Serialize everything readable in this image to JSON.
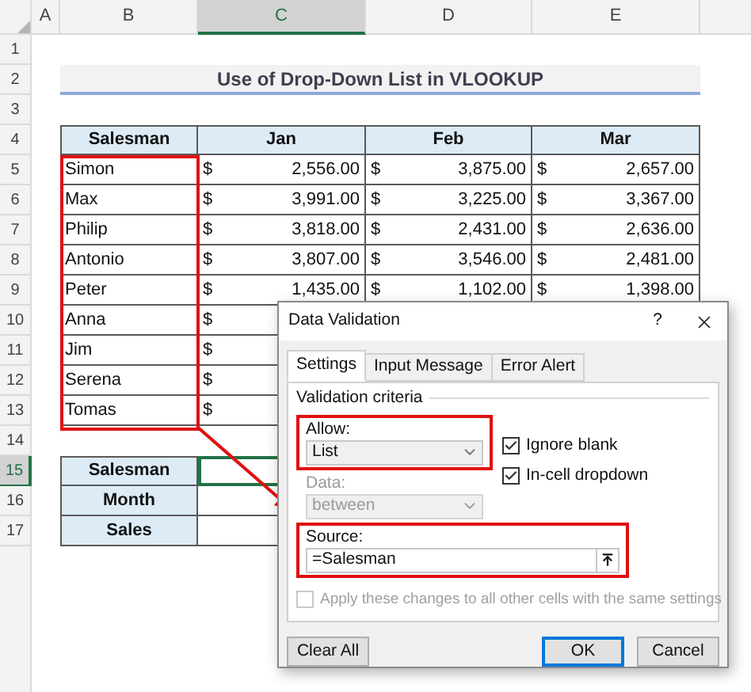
{
  "sheet": {
    "columns": [
      {
        "label": "A",
        "selected": false
      },
      {
        "label": "B",
        "selected": false
      },
      {
        "label": "C",
        "selected": true
      },
      {
        "label": "D",
        "selected": false
      },
      {
        "label": "E",
        "selected": false
      }
    ],
    "row_numbers": [
      {
        "label": "1",
        "selected": false
      },
      {
        "label": "2",
        "selected": false
      },
      {
        "label": "3",
        "selected": false
      },
      {
        "label": "4",
        "selected": false
      },
      {
        "label": "5",
        "selected": false
      },
      {
        "label": "6",
        "selected": false
      },
      {
        "label": "7",
        "selected": false
      },
      {
        "label": "8",
        "selected": false
      },
      {
        "label": "9",
        "selected": false
      },
      {
        "label": "10",
        "selected": false
      },
      {
        "label": "11",
        "selected": false
      },
      {
        "label": "12",
        "selected": false
      },
      {
        "label": "13",
        "selected": false
      },
      {
        "label": "14",
        "selected": false
      },
      {
        "label": "15",
        "selected": true
      },
      {
        "label": "16",
        "selected": false
      },
      {
        "label": "17",
        "selected": false
      }
    ],
    "title": "Use of Drop-Down List in VLOOKUP",
    "table": {
      "columns": [
        "Salesman",
        "Jan",
        "Feb",
        "Mar"
      ],
      "rows": [
        {
          "cells": [
            {
              "text": "Simon"
            },
            {
              "currency": "$",
              "amount": "2,556.00"
            },
            {
              "currency": "$",
              "amount": "3,875.00"
            },
            {
              "currency": "$",
              "amount": "2,657.00"
            }
          ]
        },
        {
          "cells": [
            {
              "text": "Max"
            },
            {
              "currency": "$",
              "amount": "3,991.00"
            },
            {
              "currency": "$",
              "amount": "3,225.00"
            },
            {
              "currency": "$",
              "amount": "3,367.00"
            }
          ]
        },
        {
          "cells": [
            {
              "text": "Philip"
            },
            {
              "currency": "$",
              "amount": "3,818.00"
            },
            {
              "currency": "$",
              "amount": "2,431.00"
            },
            {
              "currency": "$",
              "amount": "2,636.00"
            }
          ]
        },
        {
          "cells": [
            {
              "text": "Antonio"
            },
            {
              "currency": "$",
              "amount": "3,807.00"
            },
            {
              "currency": "$",
              "amount": "3,546.00"
            },
            {
              "currency": "$",
              "amount": "2,481.00"
            }
          ]
        },
        {
          "cells": [
            {
              "text": "Peter"
            },
            {
              "currency": "$",
              "amount": "1,435.00"
            },
            {
              "currency": "$",
              "amount": "1,102.00"
            },
            {
              "currency": "$",
              "amount": "1,398.00"
            }
          ]
        },
        {
          "cells": [
            {
              "text": "Anna"
            },
            {
              "currency": "$"
            }
          ]
        },
        {
          "cells": [
            {
              "text": "Jim"
            },
            {
              "currency": "$"
            }
          ]
        },
        {
          "cells": [
            {
              "text": "Serena"
            },
            {
              "currency": "$"
            }
          ]
        },
        {
          "cells": [
            {
              "text": "Tomas"
            },
            {
              "currency": "$"
            }
          ]
        }
      ]
    },
    "summary": [
      {
        "label": "Salesman",
        "selected": true
      },
      {
        "label": "Month",
        "selected": false
      },
      {
        "label": "Sales",
        "selected": false
      }
    ]
  },
  "dialog": {
    "title": "Data Validation",
    "help": "?",
    "tabs": [
      {
        "label": "Settings",
        "selected": true
      },
      {
        "label": "Input Message",
        "selected": false
      },
      {
        "label": "Error Alert",
        "selected": false
      }
    ],
    "group_title": "Validation criteria",
    "allow": {
      "label": "Allow:",
      "value": "List"
    },
    "options": [
      {
        "label": "Ignore blank",
        "checked": true
      },
      {
        "label": "In-cell dropdown",
        "checked": true
      }
    ],
    "data": {
      "label": "Data:",
      "value": "between",
      "disabled": true
    },
    "source": {
      "label": "Source:",
      "value": "=Salesman"
    },
    "apply_all": {
      "label": "Apply these changes to all other cells with the same settings",
      "checked": false,
      "disabled": true
    },
    "buttons": [
      {
        "label": "Clear All",
        "default": false
      },
      {
        "label": "OK",
        "default": true
      },
      {
        "label": "Cancel",
        "default": false
      }
    ]
  }
}
